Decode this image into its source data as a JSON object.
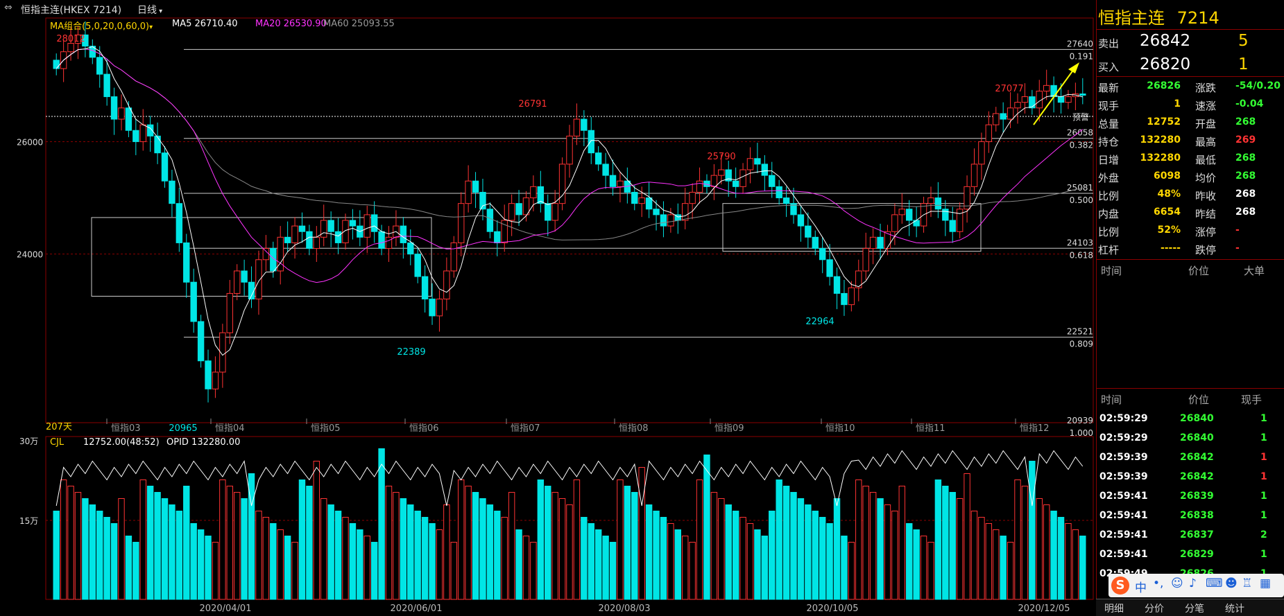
{
  "window": {
    "menu_icon": "chart-toggle-icon",
    "symbol_title": "恒指主连(HKEX 7214)",
    "period": "日线"
  },
  "ma_legend": {
    "group": "MA组合(5,0,20,0,60,0)",
    "ma5": "MA5 26710.40",
    "ma20": "MA20 26530.90",
    "ma60": "MA60 25093.55",
    "colors": {
      "ma5": "#ffffff",
      "ma20": "#ff33ff",
      "ma60": "#888888"
    }
  },
  "price_axis": [
    "26000",
    "24000"
  ],
  "fib_levels": [
    {
      "price": "27640",
      "ratio": "0.191",
      "pos": 0
    },
    {
      "price": "26058",
      "ratio": "0.382",
      "pos": 1
    },
    {
      "price": "25081",
      "ratio": "0.500",
      "pos": 2
    },
    {
      "price": "24103",
      "ratio": "0.618",
      "pos": 3
    },
    {
      "price": "22521",
      "ratio": "0.809",
      "pos": 4
    },
    {
      "price": "20939",
      "ratio": "1.000",
      "pos": 5
    }
  ],
  "alert_label": "预警",
  "extreme_labels": [
    {
      "text": "28012",
      "kind": "high"
    },
    {
      "text": "26791",
      "kind": "high"
    },
    {
      "text": "25790",
      "kind": "high"
    },
    {
      "text": "27077",
      "kind": "high"
    },
    {
      "text": "22389",
      "kind": "low"
    },
    {
      "text": "22964",
      "kind": "low"
    },
    {
      "text": "20965",
      "kind": "low"
    }
  ],
  "bar_count": "207天",
  "month_labels": [
    "恒指03",
    "恒指04",
    "恒指05",
    "恒指06",
    "恒指07",
    "恒指08",
    "恒指09",
    "恒指10",
    "恒指11",
    "恒指12"
  ],
  "volume_panel": {
    "scale_top": "30万",
    "scale_mid": "15万",
    "indicator": "CJL",
    "volume_value": "12752.00(48:52)",
    "opid_value": "OPID 132280.00"
  },
  "date_labels": [
    "2020/04/01",
    "2020/06/01",
    "2020/08/03",
    "2020/10/05",
    "2020/12/05"
  ],
  "quote": {
    "name": "恒指主连",
    "code": "7214",
    "ask_label": "卖出",
    "ask_price": "26842",
    "ask_vol": "5",
    "bid_label": "买入",
    "bid_price": "26820",
    "bid_vol": "1",
    "rows": [
      {
        "l1": "最新",
        "v1": "26826",
        "c1": "g",
        "l2": "涨跌",
        "v2": "-54/0.20",
        "c2": "g"
      },
      {
        "l1": "现手",
        "v1": "1",
        "c1": "y",
        "l2": "速涨",
        "v2": "-0.04",
        "c2": "g"
      },
      {
        "l1": "总量",
        "v1": "12752",
        "c1": "y",
        "l2": "开盘",
        "v2": "268",
        "c2": "g"
      },
      {
        "l1": "持仓",
        "v1": "132280",
        "c1": "y",
        "l2": "最高",
        "v2": "269",
        "c2": "r"
      },
      {
        "l1": "日增",
        "v1": "132280",
        "c1": "y",
        "l2": "最低",
        "v2": "268",
        "c2": "g"
      },
      {
        "l1": "外盘",
        "v1": "6098",
        "c1": "y",
        "l2": "均价",
        "v2": "268",
        "c2": "g"
      },
      {
        "l1": "比例",
        "v1": "48%",
        "c1": "y",
        "l2": "昨收",
        "v2": "268",
        "c2": "w"
      },
      {
        "l1": "内盘",
        "v1": "6654",
        "c1": "y",
        "l2": "昨结",
        "v2": "268",
        "c2": "w"
      },
      {
        "l1": "比例",
        "v1": "52%",
        "c1": "y",
        "l2": "涨停",
        "v2": "-",
        "c2": "r"
      },
      {
        "l1": "杠杆",
        "v1": "-----",
        "c1": "y",
        "l2": "跌停",
        "v2": "-",
        "c2": "r"
      }
    ],
    "big_header": {
      "time": "时间",
      "price": "价位",
      "big": "大单"
    },
    "tick_header": {
      "time": "时间",
      "price": "价位",
      "hand": "现手"
    },
    "ticks": [
      {
        "time": "02:59:29",
        "price": "26840",
        "vol": "1",
        "vc": "g"
      },
      {
        "time": "02:59:29",
        "price": "26840",
        "vol": "1",
        "vc": "g"
      },
      {
        "time": "02:59:39",
        "price": "26842",
        "vol": "1",
        "vc": "r"
      },
      {
        "time": "02:59:39",
        "price": "26842",
        "vol": "1",
        "vc": "r"
      },
      {
        "time": "02:59:41",
        "price": "26839",
        "vol": "1",
        "vc": "g"
      },
      {
        "time": "02:59:41",
        "price": "26838",
        "vol": "1",
        "vc": "g"
      },
      {
        "time": "02:59:41",
        "price": "26837",
        "vol": "2",
        "vc": "g"
      },
      {
        "time": "02:59:41",
        "price": "26829",
        "vol": "1",
        "vc": "g"
      },
      {
        "time": "02:59:49",
        "price": "26826",
        "vol": "1",
        "vc": "g"
      }
    ],
    "tabs": [
      "明细",
      "分价",
      "分笔",
      "统计"
    ]
  },
  "ime_bar": {
    "label": "中"
  },
  "chart_data": {
    "type": "candlestick",
    "price_ylim": [
      20939,
      27640
    ],
    "fib_prices": [
      27640,
      26058,
      25081,
      24103,
      22521,
      20939
    ],
    "marked_highs": [
      28012,
      26791,
      25790,
      27077
    ],
    "marked_lows": [
      22389,
      22964,
      20965
    ],
    "series_close": [
      27300,
      27600,
      27750,
      27900,
      27700,
      27500,
      27200,
      26800,
      26400,
      26600,
      26200,
      26000,
      26300,
      26100,
      25800,
      25300,
      24900,
      24200,
      23500,
      22800,
      22100,
      21600,
      21900,
      22600,
      23300,
      23700,
      23500,
      23200,
      23900,
      24100,
      23700,
      24300,
      24200,
      24500,
      24400,
      24100,
      24300,
      24600,
      24400,
      24200,
      24600,
      24500,
      24300,
      24700,
      24400,
      24100,
      24300,
      24500,
      24200,
      24000,
      23600,
      23200,
      22900,
      23200,
      23700,
      24200,
      24900,
      25300,
      25100,
      24800,
      24400,
      24200,
      24600,
      24900,
      24700,
      25000,
      25200,
      24900,
      24600,
      24900,
      25600,
      26100,
      26400,
      26200,
      25800,
      25600,
      25400,
      25200,
      25300,
      25100,
      24900,
      25000,
      24800,
      24700,
      24500,
      24700,
      24600,
      24900,
      25100,
      25300,
      25200,
      25400,
      25500,
      25300,
      25200,
      25500,
      25700,
      25600,
      25400,
      25200,
      25000,
      24900,
      24700,
      24500,
      24300,
      24100,
      23900,
      23600,
      23300,
      23100,
      23400,
      23700,
      24100,
      24300,
      24100,
      24400,
      24700,
      24800,
      24600,
      24500,
      24900,
      25000,
      24800,
      24600,
      24400,
      24800,
      25200,
      25600,
      26000,
      26300,
      26500,
      26400,
      26600,
      26700,
      26800,
      26600,
      26900,
      27000,
      26800,
      26700,
      26800,
      26850,
      26826
    ],
    "volume_ylim": [
      0,
      300000
    ],
    "volume_levels": [
      150000,
      300000
    ]
  }
}
